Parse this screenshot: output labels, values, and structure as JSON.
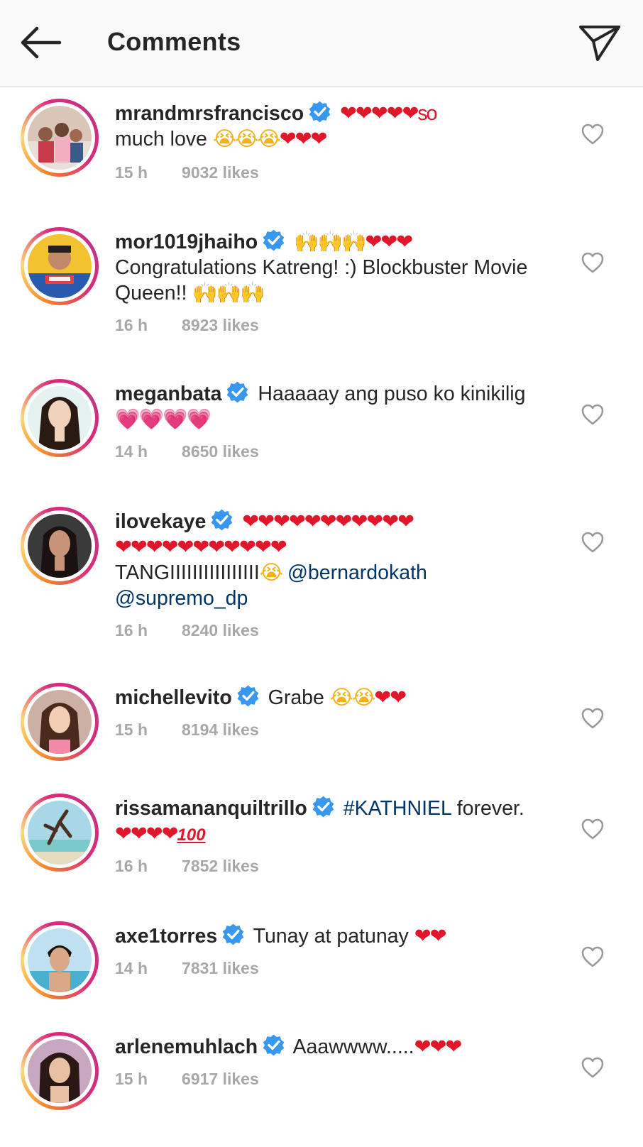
{
  "header": {
    "title": "Comments",
    "back_icon": "arrow-left-icon",
    "share_icon": "paper-plane-icon"
  },
  "colors": {
    "mention": "#003569",
    "meta": "#a8a8a8",
    "verified": "#3897f0",
    "heart": "#e0162b"
  },
  "comments": [
    {
      "username": "mrandmrsfrancisco",
      "text_main": "❤❤❤❤❤so",
      "text_line2": "much love ",
      "emoji_cry": "😭😭😭",
      "emoji_heart": "❤❤❤",
      "time": "15 h",
      "likes": "9032 likes"
    },
    {
      "username": "mor1019jhaiho",
      "emoji_hands": "🙌🙌🙌",
      "emoji_heart": "❤❤❤",
      "text_main": "Congratulations Katreng! :) Blockbuster Movie Queen!! ",
      "emoji_hands2": "🙌🙌🙌",
      "time": "16 h",
      "likes": "8923 likes"
    },
    {
      "username": "meganbata",
      "text_main": "Haaaaay ang puso ko kinikilig",
      "emoji_heart": "💗💗💗💗",
      "time": "14 h",
      "likes": "8650 likes"
    },
    {
      "username": "ilovekaye",
      "emoji_heart": "❤❤❤❤❤❤❤❤❤❤❤",
      "emoji_heart2": "❤❤❤❤❤❤❤❤❤❤❤",
      "text_main": "TANGIIIIIIIIIIIIIIII",
      "emoji_cry": "😭",
      "mention1": "@bernardokath",
      "mention2": "@supremo_dp",
      "time": "16 h",
      "likes": "8240 likes"
    },
    {
      "username": "michellevito",
      "text_main": "Grabe ",
      "emoji_cry": "😭😭",
      "emoji_heart": "❤❤",
      "time": "15 h",
      "likes": "8194 likes"
    },
    {
      "username": "rissamananquiltrillo",
      "hashtag": "#KATHNIEL",
      "text_main": " forever.",
      "emoji_heart": "❤❤❤❤",
      "emoji_100": "100",
      "time": "16 h",
      "likes": "7852 likes"
    },
    {
      "username": "axe1torres",
      "text_main": "Tunay at patunay ",
      "emoji_heart": "❤❤",
      "time": "14 h",
      "likes": "7831 likes"
    },
    {
      "username": "arlenemuhlach",
      "text_main": "Aaawwww.....",
      "emoji_heart": "❤❤❤",
      "time": "15 h",
      "likes": "6917 likes"
    }
  ]
}
